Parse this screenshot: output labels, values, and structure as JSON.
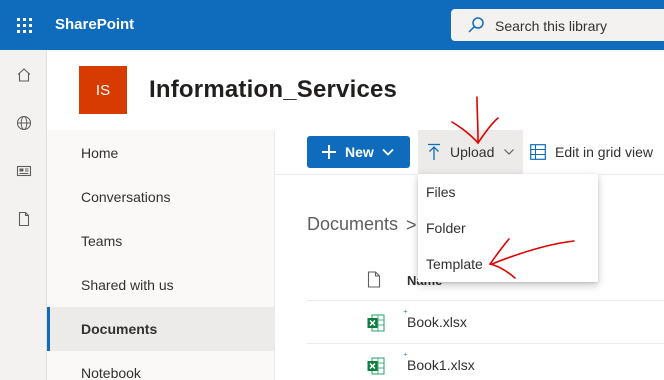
{
  "suite": {
    "brand": "SharePoint",
    "search_placeholder": "Search this library"
  },
  "rail": {
    "items": [
      "home-icon",
      "globe-icon",
      "news-icon",
      "document-icon"
    ]
  },
  "site": {
    "logo_initials": "IS",
    "title": "Information_Services",
    "logo_color": "#d83b01"
  },
  "nav": {
    "items": [
      {
        "label": "Home"
      },
      {
        "label": "Conversations"
      },
      {
        "label": "Teams"
      },
      {
        "label": "Shared with us"
      },
      {
        "label": "Documents"
      },
      {
        "label": "Notebook"
      }
    ],
    "selected": "Documents"
  },
  "command_bar": {
    "new_label": "New",
    "upload_label": "Upload",
    "grid_label": "Edit in grid view"
  },
  "upload_menu": {
    "items": [
      "Files",
      "Folder",
      "Template"
    ]
  },
  "breadcrumb": {
    "root": "Documents",
    "separator": ">"
  },
  "list": {
    "column_name": "Name",
    "files": [
      {
        "name": "Book.xlsx",
        "icon": "excel-icon"
      },
      {
        "name": "Book1.xlsx",
        "icon": "excel-icon"
      }
    ]
  },
  "colors": {
    "accent": "#0f6cbd",
    "annotation": "#e00000"
  }
}
